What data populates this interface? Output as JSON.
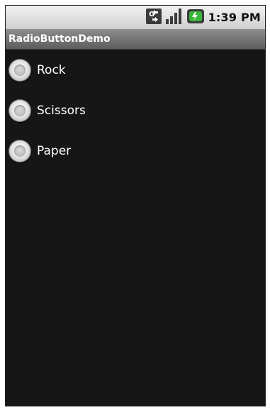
{
  "status_bar": {
    "time": "1:39 PM",
    "icons": [
      "network-type-icon",
      "signal-strength-icon",
      "battery-charging-icon"
    ]
  },
  "app": {
    "title": "RadioButtonDemo"
  },
  "radio_group": {
    "options": [
      {
        "label": "Rock",
        "checked": false
      },
      {
        "label": "Scissors",
        "checked": false
      },
      {
        "label": "Paper",
        "checked": false
      }
    ]
  },
  "colors": {
    "background": "#161616",
    "title_bar": "#6f6f6f",
    "status_bar": "#dcdcdc",
    "text": "#ffffff"
  }
}
